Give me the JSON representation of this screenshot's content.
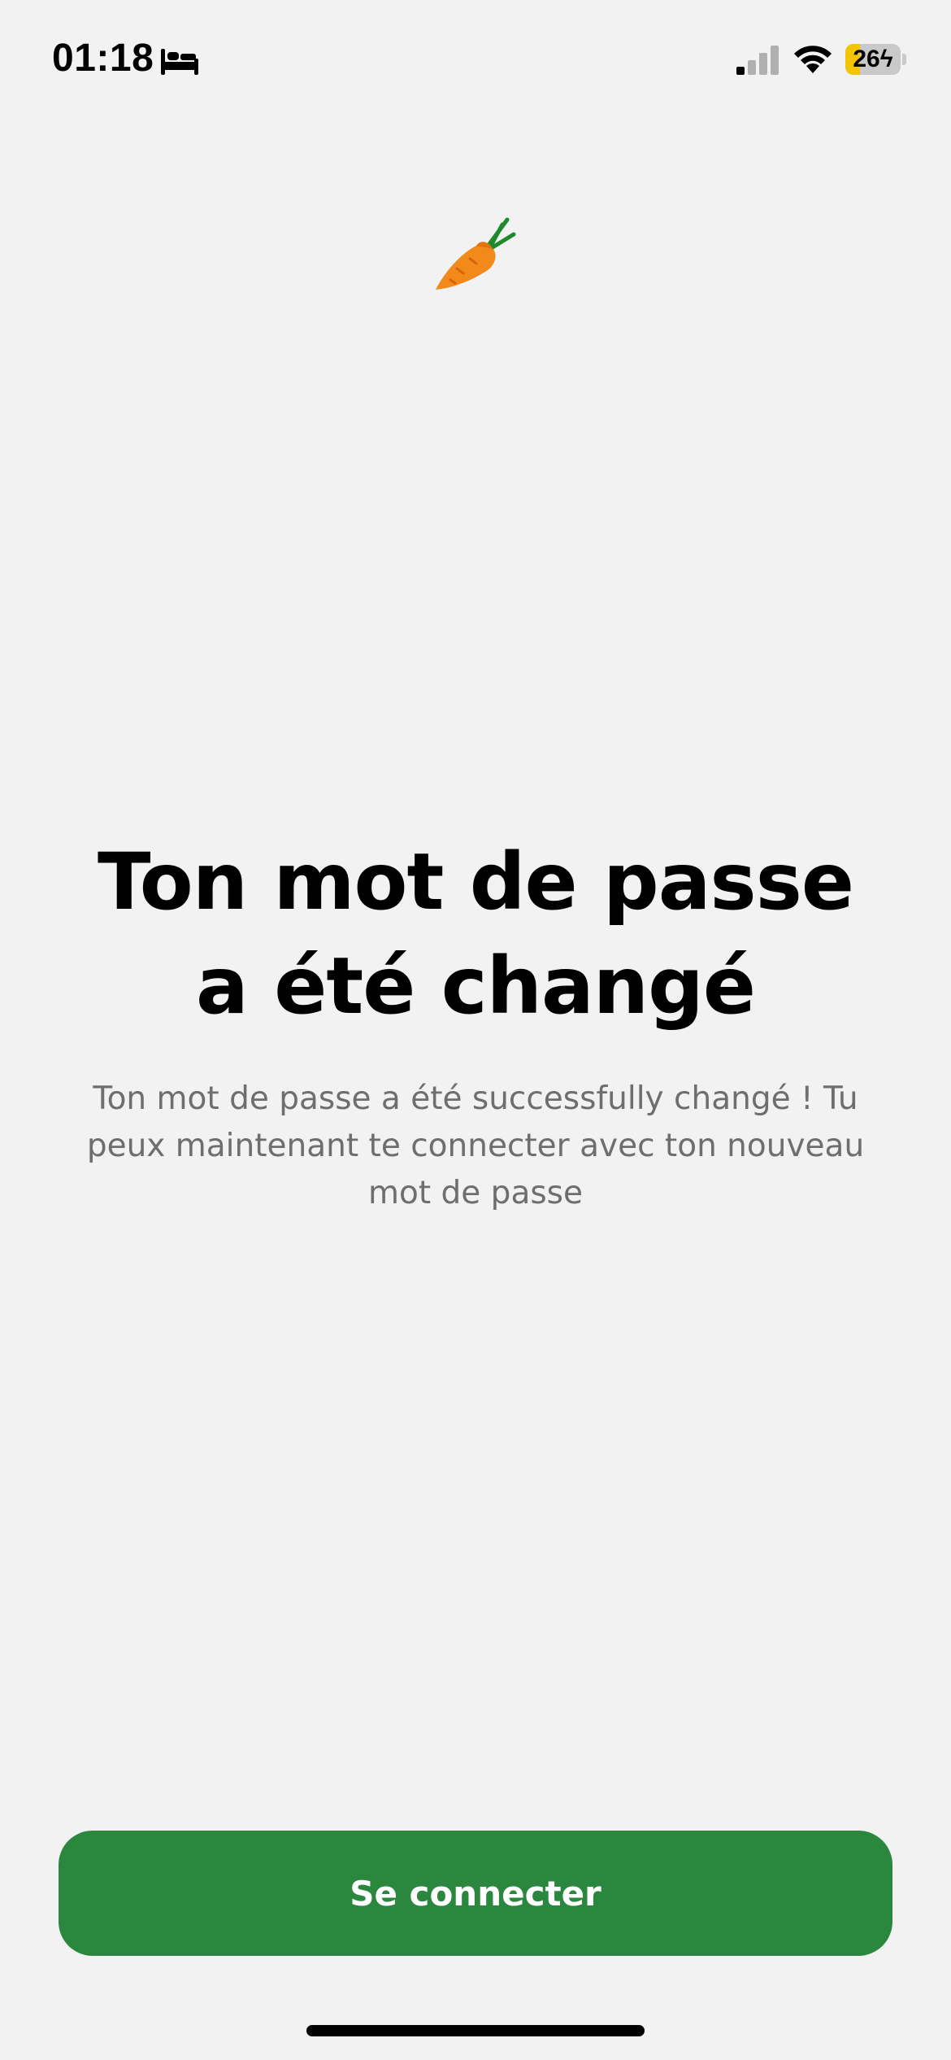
{
  "status_bar": {
    "time": "01:18",
    "sleep_icon": "bed-icon",
    "signal_icon": "cellular-signal-icon",
    "wifi_icon": "wifi-icon",
    "battery_level": "26",
    "battery_icon": "battery-charging-icon",
    "battery_fill_fraction": 0.26,
    "battery_color": "#f5c400"
  },
  "logo": {
    "icon": "carrot-icon"
  },
  "main": {
    "title": "Ton mot de passe a été changé",
    "description": "Ton mot de passe a été successfully changé ! Tu peux maintenant te connecter avec ton nouveau mot de passe"
  },
  "actions": {
    "login_label": "Se connecter",
    "accent_color": "#2b873e"
  }
}
